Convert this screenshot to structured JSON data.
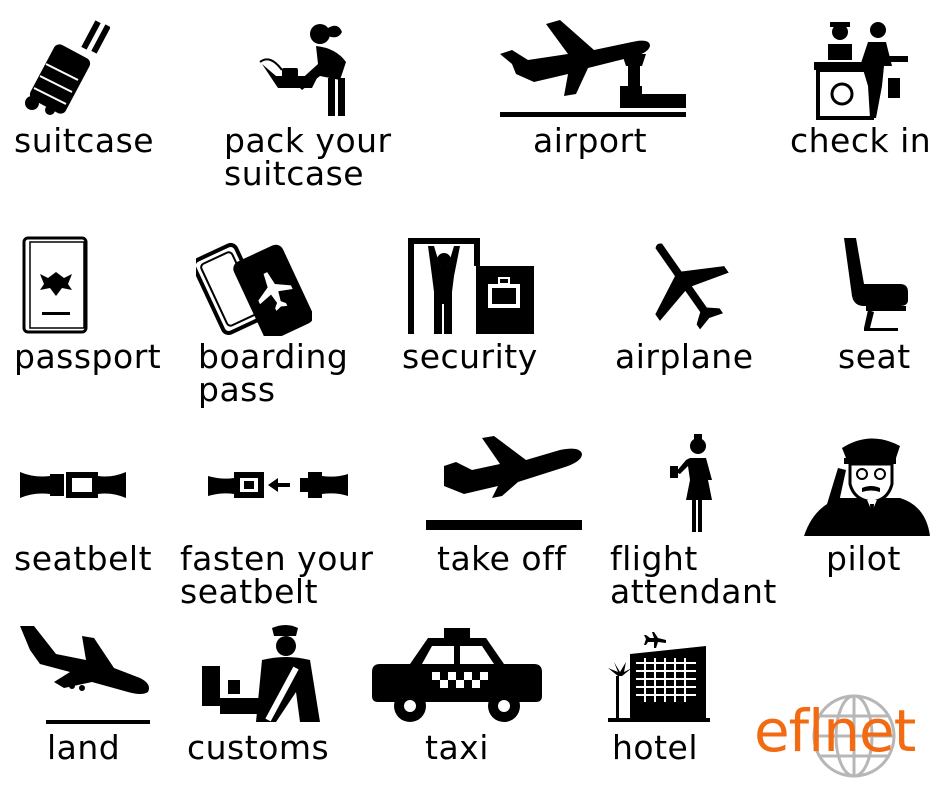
{
  "accent_color": "#f26b12",
  "logo_globe_color": "#b7b7b7",
  "icon_color": "#000000",
  "items": [
    {
      "key": "suitcase",
      "lines": [
        "suitcase"
      ],
      "icon": "suitcase-icon"
    },
    {
      "key": "pack",
      "lines": [
        "pack your",
        "suitcase"
      ],
      "icon": "packing-person-icon"
    },
    {
      "key": "airport",
      "lines": [
        "airport"
      ],
      "icon": "airport-icon"
    },
    {
      "key": "checkin",
      "lines": [
        "check in"
      ],
      "icon": "check-in-desk-icon"
    },
    {
      "key": "passport",
      "lines": [
        "passport"
      ],
      "icon": "passport-icon"
    },
    {
      "key": "boarding",
      "lines": [
        "boarding",
        "pass"
      ],
      "icon": "boarding-pass-icon"
    },
    {
      "key": "security",
      "lines": [
        "security"
      ],
      "icon": "security-gate-icon"
    },
    {
      "key": "airplane",
      "lines": [
        "airplane"
      ],
      "icon": "airplane-icon"
    },
    {
      "key": "seat",
      "lines": [
        "seat"
      ],
      "icon": "seat-icon"
    },
    {
      "key": "seatbelt",
      "lines": [
        "seatbelt"
      ],
      "icon": "seatbelt-icon"
    },
    {
      "key": "fasten",
      "lines": [
        "fasten your",
        "seatbelt"
      ],
      "icon": "fasten-seatbelt-icon"
    },
    {
      "key": "takeoff",
      "lines": [
        "take off"
      ],
      "icon": "takeoff-icon"
    },
    {
      "key": "attendant",
      "lines": [
        "flight",
        "attendant"
      ],
      "icon": "flight-attendant-icon"
    },
    {
      "key": "pilot",
      "lines": [
        "pilot"
      ],
      "icon": "pilot-icon"
    },
    {
      "key": "land",
      "lines": [
        "land"
      ],
      "icon": "landing-icon"
    },
    {
      "key": "customs",
      "lines": [
        "customs"
      ],
      "icon": "customs-officer-icon"
    },
    {
      "key": "taxi",
      "lines": [
        "taxi"
      ],
      "icon": "taxi-icon"
    },
    {
      "key": "hotel",
      "lines": [
        "hotel"
      ],
      "icon": "hotel-icon"
    }
  ],
  "logo": {
    "text": "eflnet",
    "icon": "globe-icon"
  }
}
